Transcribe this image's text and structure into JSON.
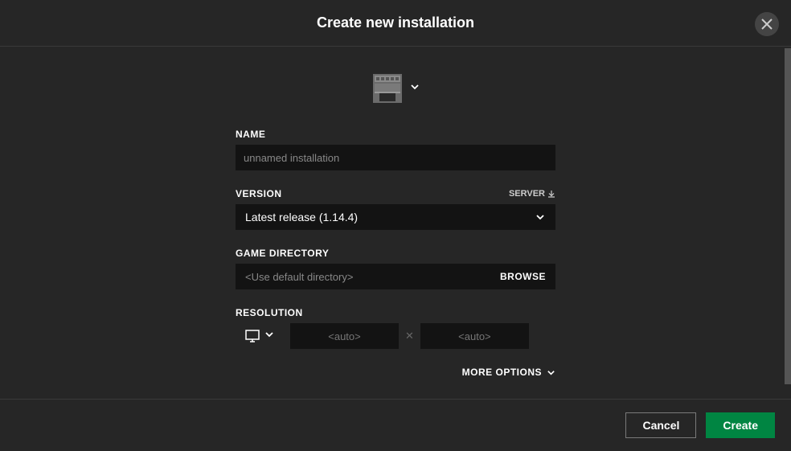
{
  "header": {
    "title": "Create new installation"
  },
  "form": {
    "nameLabel": "NAME",
    "namePlaceholder": "unnamed installation",
    "nameValue": "",
    "versionLabel": "VERSION",
    "serverLabel": "SERVER",
    "versionSelected": "Latest release (1.14.4)",
    "gameDirectoryLabel": "GAME DIRECTORY",
    "gameDirectoryPlaceholder": "<Use default directory>",
    "gameDirectoryValue": "",
    "browseLabel": "BROWSE",
    "resolutionLabel": "RESOLUTION",
    "widthPlaceholder": "<auto>",
    "heightPlaceholder": "<auto>",
    "moreOptions": "MORE OPTIONS"
  },
  "footer": {
    "cancel": "Cancel",
    "create": "Create"
  }
}
